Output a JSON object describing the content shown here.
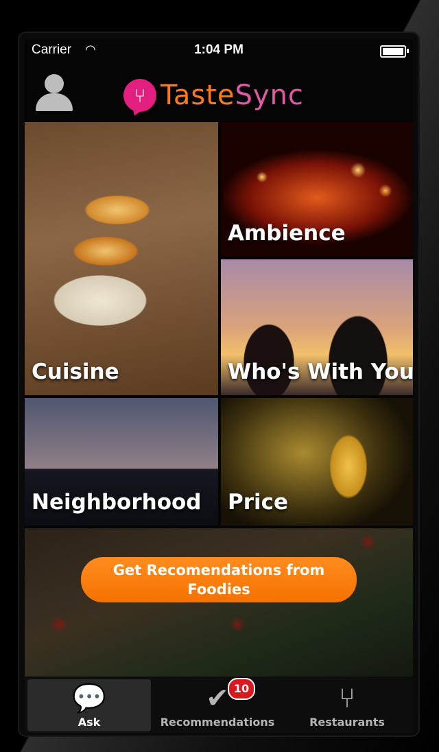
{
  "status_bar": {
    "carrier": "Carrier",
    "time": "1:04 PM",
    "wifi_icon": "wifi-icon"
  },
  "header": {
    "logo_part1": "Taste",
    "logo_part2": "Sync",
    "logo_icon": "fork-bubble-icon",
    "user_icon": "user-icon"
  },
  "tiles": {
    "cuisine": "Cuisine",
    "ambience": "Ambience",
    "whos_with_you": "Who's With You",
    "neighborhood": "Neighborhood",
    "price": "Price"
  },
  "cta": {
    "label": "Get Recomendations from Foodies"
  },
  "tabbar": {
    "tabs": [
      {
        "label": "Ask",
        "icon": "speech-bubbles-icon",
        "active": true
      },
      {
        "label": "Recommendations",
        "icon": "check-bubble-icon",
        "badge": "10"
      },
      {
        "label": "Restaurants",
        "icon": "fork-knife-icon"
      }
    ]
  },
  "colors": {
    "brand_orange": "#ff7a1a",
    "brand_pink": "#e21f7e",
    "badge_red": "#d71920"
  }
}
